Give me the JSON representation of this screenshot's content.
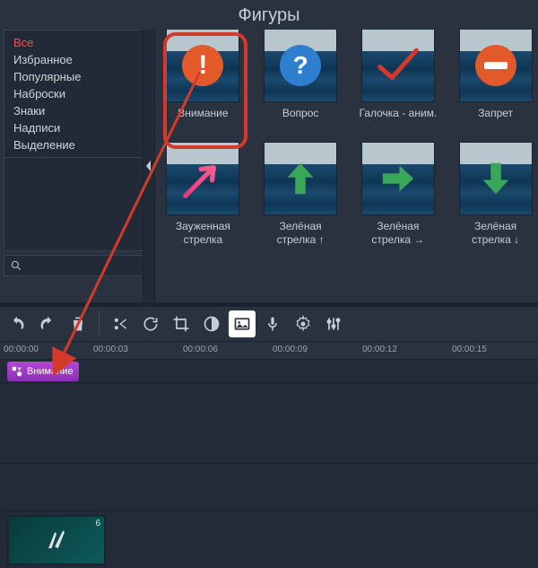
{
  "panel": {
    "title": "Фигуры"
  },
  "sidebar": {
    "items": [
      {
        "label": "Все",
        "active": true
      },
      {
        "label": "Избранное"
      },
      {
        "label": "Популярные"
      },
      {
        "label": "Наброски"
      },
      {
        "label": "Знаки"
      },
      {
        "label": "Надписи"
      },
      {
        "label": "Выделение"
      }
    ]
  },
  "shapes": [
    {
      "label": "Внимание",
      "icon": "exclaim",
      "selected": true
    },
    {
      "label": "Вопрос",
      "icon": "question"
    },
    {
      "label": "Галочка - аним.",
      "icon": "check-red"
    },
    {
      "label": "Запрет",
      "icon": "no-entry"
    },
    {
      "label": "Зауженная стрелка",
      "icon": "arrow-pink-ne"
    },
    {
      "label": "Зелёная стрелка ↑",
      "icon": "arrow-green-up"
    },
    {
      "label": "Зелёная стрелка →",
      "icon": "arrow-green-right"
    },
    {
      "label": "Зелёная стрелка ↓",
      "icon": "arrow-green-down"
    }
  ],
  "ruler": {
    "ticks": [
      "00:00:00",
      "00:00:03",
      "00:00:06",
      "00:00:09",
      "00:00:12",
      "00:00:15"
    ]
  },
  "timeline": {
    "clip_label": "Внимание",
    "media_duration": "6"
  }
}
